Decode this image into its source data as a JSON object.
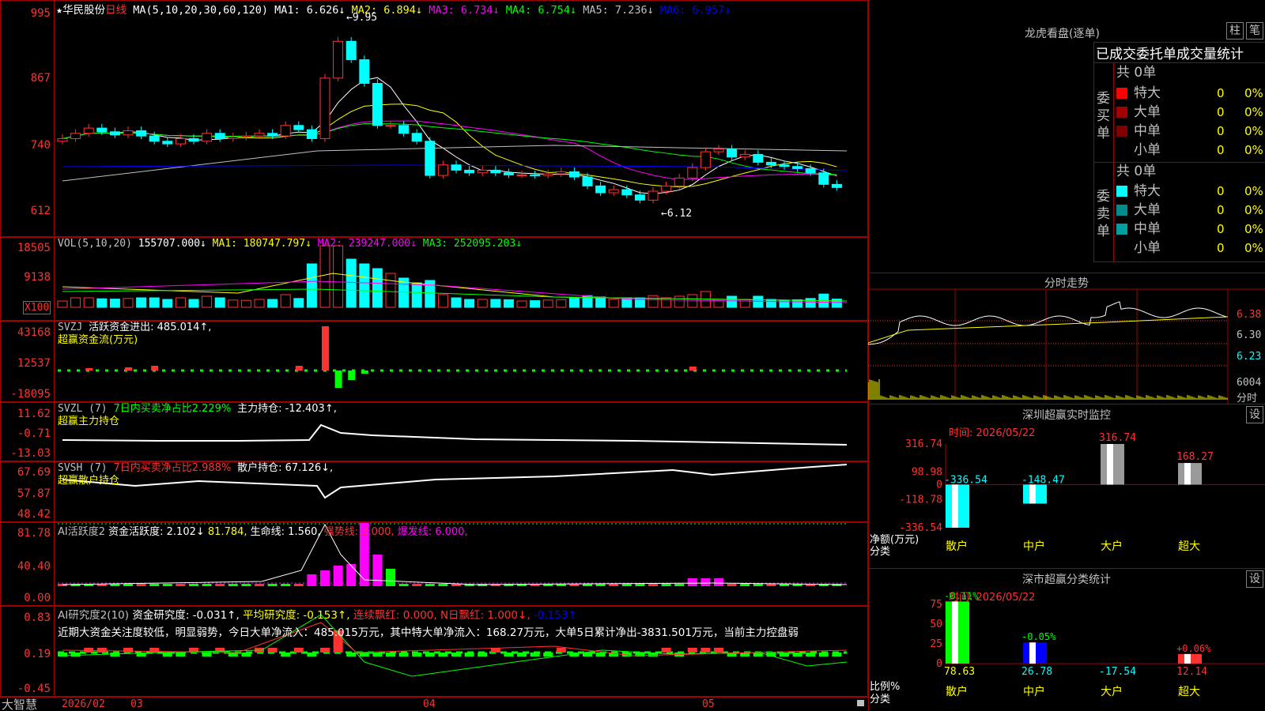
{
  "stock": {
    "star": "★",
    "name": "华民股份",
    "period": "日线",
    "ma_params": "MA(5,10,20,30,60,120)",
    "ma": [
      {
        "label": "MA1:",
        "value": "6.626↓",
        "color": "#ffffff"
      },
      {
        "label": "MA2:",
        "value": "6.894↓",
        "color": "#ffff00"
      },
      {
        "label": "MA3:",
        "value": "6.734↓",
        "color": "#ff00ff"
      },
      {
        "label": "MA4:",
        "value": "6.754↓",
        "color": "#00ff00"
      },
      {
        "label": "MA5:",
        "value": "7.236↓",
        "color": "#c0c0c0"
      },
      {
        "label": "MA6:",
        "value": "6.957↓",
        "color": "#0000ff"
      }
    ],
    "high_label": "9.95",
    "low_label": "6.12"
  },
  "price_axis": [
    "995",
    "867",
    "740",
    "612"
  ],
  "vol": {
    "title": "VOL(5,10,20)",
    "value": "155707.000↓",
    "ma1": "MA1: 180747.797↓",
    "ma2": "MA2: 239247.000↓",
    "ma3": "MA3: 252095.203↓",
    "axis": [
      "18505",
      "9138"
    ],
    "unit": "X100"
  },
  "svzj": {
    "title": "SVZJ",
    "line1": "活跃资金进出: 485.014↑,",
    "line2": "超赢资金流(万元)",
    "axis": [
      "43168",
      "12537",
      "-18095"
    ]
  },
  "svzl": {
    "title": "SVZL (7)",
    "ratio": "7日内买卖净占比2.229%",
    "hold": "主力持仓: -12.403↑,",
    "line2": "超赢主力持仓",
    "axis": [
      "11.62",
      "-0.71",
      "-13.03"
    ]
  },
  "svsh": {
    "title": "SVSH (7)",
    "ratio": "7日内买卖净占比2.988%",
    "hold": "散户持仓: 67.126↓,",
    "line2": "超赢散户持仓",
    "axis": [
      "67.69",
      "57.87",
      "48.42"
    ]
  },
  "ai": {
    "title": "AI活跃度2",
    "active": "资金活跃度: 2.102↓",
    "v2": "81.784,",
    "life": "生命线: 1.560,",
    "strong": "强势线: 3.000,",
    "burst": "爆发线: 6.000,",
    "axis": [
      "81.78",
      "40.40",
      "0.00"
    ]
  },
  "air": {
    "title": "AI研究度2(10)",
    "research": "资金研究度: -0.031↑,",
    "avg": "平均研究度: -0.153↑,",
    "red": "连续飘红: 0.000,",
    "nred": "N日飘红: 1.000↓,",
    "last": "-0.153↑",
    "comment": "近期大资金关注度较低，明显弱势，今日大单净流入：485.015万元，其中特大单净流入：168.27万元，大单5日累计净出-3831.501万元，当前主力控盘弱",
    "axis": [
      "0.83",
      "0.19",
      "-0.45"
    ]
  },
  "xaxis": {
    "brand": "大智慧",
    "labels": [
      "2026/02",
      "03",
      "04",
      "05"
    ]
  },
  "lh": {
    "title": "龙虎看盘(逐单)",
    "btn1": "柱",
    "btn2": "笔",
    "sub": "已成交委托单成交量统计",
    "buy_label": "委买单",
    "sell_label": "委卖单",
    "buy_total": "共 0单",
    "sell_total": "共 0单",
    "buy": [
      {
        "name": "特大",
        "n": "0",
        "p": "0%",
        "color": "#ff0000"
      },
      {
        "name": "大单",
        "n": "0",
        "p": "0%",
        "color": "#a00000"
      },
      {
        "name": "中单",
        "n": "0",
        "p": "0%",
        "color": "#800000"
      },
      {
        "name": "小单",
        "n": "0",
        "p": "0%",
        "color": "#000000"
      }
    ],
    "sell": [
      {
        "name": "特大",
        "n": "0",
        "p": "0%",
        "color": "#00ffff"
      },
      {
        "name": "大单",
        "n": "0",
        "p": "0%",
        "color": "#008c8c"
      },
      {
        "name": "中单",
        "n": "0",
        "p": "0%",
        "color": "#00a0a0"
      },
      {
        "name": "小单",
        "n": "0",
        "p": "0%",
        "color": "#000000"
      }
    ]
  },
  "fs": {
    "title": "分时走势",
    "axis": [
      "6.38",
      "6.30",
      "6.23"
    ],
    "vol": "6004",
    "vol_unit": "分时"
  },
  "sz": {
    "title": "深圳超赢实时监控",
    "btn": "设",
    "date": "时间: 2026/05/22",
    "axis": [
      "316.74",
      "98.98",
      "0",
      "-118.78",
      "-336.54"
    ],
    "ylab": "净额(万元)",
    "cat": "分类",
    "chart_data": {
      "type": "bar",
      "categories": [
        "散户",
        "中户",
        "大户",
        "超大"
      ],
      "values": [
        -336.54,
        -148.47,
        316.74,
        168.27
      ],
      "labels": [
        "-336.54",
        "-148.47",
        "316.74",
        "168.27"
      ],
      "ylim": [
        -336.54,
        316.74
      ]
    }
  },
  "sc": {
    "title": "深市超赢分类统计",
    "btn": "设",
    "date": "时间: 2026/05/22",
    "axis": [
      "75",
      "50",
      "25",
      "0"
    ],
    "ylab": "比例%",
    "cat": "分类",
    "chart_data": {
      "type": "bar",
      "categories": [
        "散户",
        "中户",
        "大户",
        "超大"
      ],
      "values": [
        78.63,
        26.78,
        -17.54,
        12.14
      ],
      "changes": [
        "-0.11%",
        "-0.05%",
        "",
        "+0.06%"
      ],
      "labels": [
        "78.63",
        "26.78",
        "-17.54",
        "12.14"
      ],
      "ylim": [
        0,
        80
      ]
    }
  }
}
